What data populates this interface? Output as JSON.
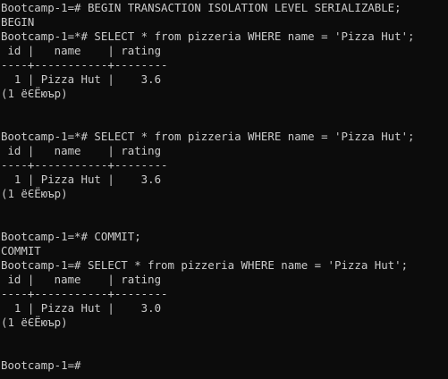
{
  "terminal": {
    "lines": [
      "Bootcamp-1=# BEGIN TRANSACTION ISOLATION LEVEL SERIALIZABLE;",
      "BEGIN",
      "Bootcamp-1=*# SELECT * from pizzeria WHERE name = 'Pizza Hut';",
      " id |   name    | rating",
      "----+-----------+--------",
      "  1 | Pizza Hut |    3.6",
      "(1 ёЄЁюър)",
      "",
      "",
      "Bootcamp-1=*# SELECT * from pizzeria WHERE name = 'Pizza Hut';",
      " id |   name    | rating",
      "----+-----------+--------",
      "  1 | Pizza Hut |    3.6",
      "(1 ёЄЁюър)",
      "",
      "",
      "Bootcamp-1=*# COMMIT;",
      "COMMIT",
      "Bootcamp-1=# SELECT * from pizzeria WHERE name = 'Pizza Hut';",
      " id |   name    | rating",
      "----+-----------+--------",
      "  1 | Pizza Hut |    3.0",
      "(1 ёЄЁюър)",
      "",
      "",
      "Bootcamp-1=#"
    ]
  }
}
